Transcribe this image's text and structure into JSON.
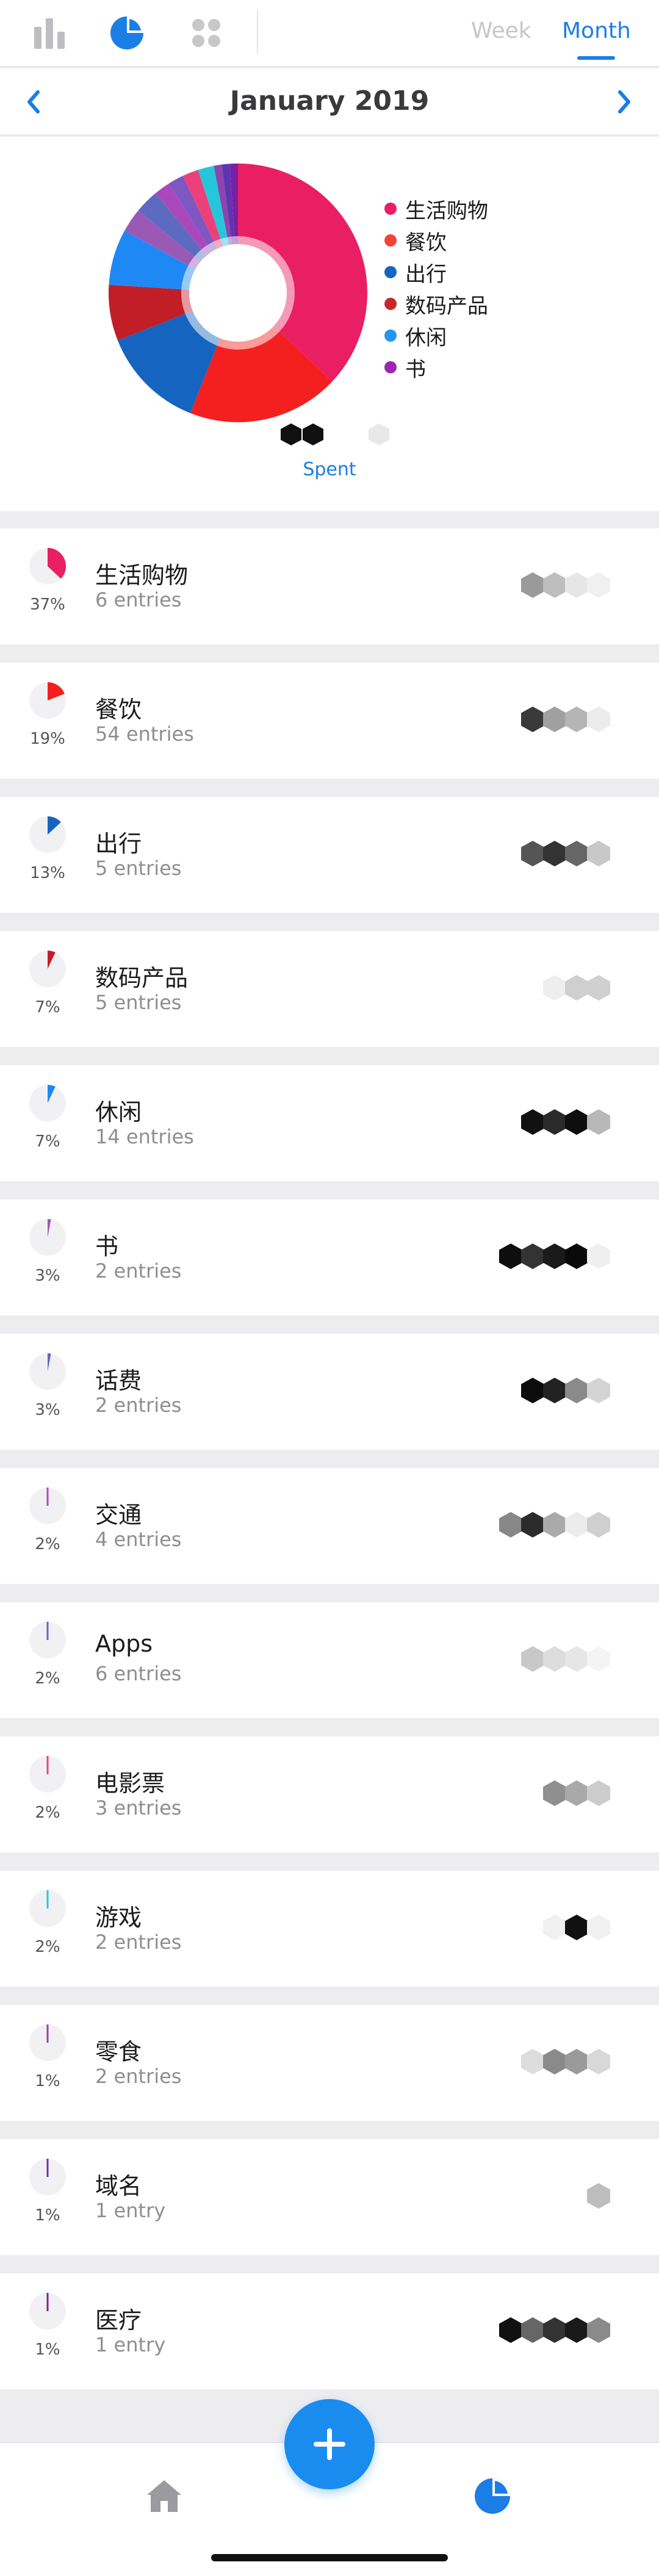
{
  "topbar": {
    "icons": [
      "bar-chart-icon",
      "pie-chart-icon",
      "grid-icon"
    ],
    "segment_week": "Week",
    "segment_month": "Month",
    "accent": "#1a7ee6"
  },
  "monthnav": {
    "title": "January 2019",
    "prev_icon": "chevron-left-icon",
    "next_icon": "chevron-right-icon"
  },
  "chart": {
    "spent_label": "Spent",
    "legend": [
      {
        "label": "生活购物",
        "color": "#e91e63"
      },
      {
        "label": "餐饮",
        "color": "#f44336"
      },
      {
        "label": "出行",
        "color": "#1565c0"
      },
      {
        "label": "数码产品",
        "color": "#c62828"
      },
      {
        "label": "休闲",
        "color": "#2196f3"
      },
      {
        "label": "书",
        "color": "#9c27b0"
      }
    ]
  },
  "chart_data": {
    "type": "pie",
    "donut": true,
    "categories": [
      "生活购物",
      "餐饮",
      "出行",
      "数码产品",
      "休闲",
      "书",
      "话费",
      "交通",
      "Apps",
      "电影票",
      "游戏",
      "零食",
      "域名",
      "医疗"
    ],
    "values": [
      37,
      19,
      13,
      7,
      7,
      3,
      3,
      2,
      2,
      2,
      2,
      1,
      1,
      1
    ],
    "colors": [
      "#e91e63",
      "#f41f1f",
      "#1565c0",
      "#c21e28",
      "#1e88f5",
      "#9b59b6",
      "#5c6bc0",
      "#ab47bc",
      "#7e57c2",
      "#ec407a",
      "#26c6da",
      "#8e44ad",
      "#5e35b1",
      "#7b1fa2"
    ]
  },
  "categories": [
    {
      "name": "生活购物",
      "entries": "6 entries",
      "pct": "37%",
      "pct_value": 37,
      "color": "#e91e63",
      "hex_shades": [
        "#9a9a9a",
        "#bdbdbd",
        "#e6e6e6",
        "#f0f0f0"
      ]
    },
    {
      "name": "餐饮",
      "entries": "54 entries",
      "pct": "19%",
      "pct_value": 19,
      "color": "#f41f1f",
      "hex_shades": [
        "#3a3a3a",
        "#a0a0a0",
        "#b5b5b5",
        "#ececec"
      ]
    },
    {
      "name": "出行",
      "entries": "5 entries",
      "pct": "13%",
      "pct_value": 13,
      "color": "#1565c0",
      "hex_shades": [
        "#555555",
        "#333333",
        "#666666",
        "#c8c8c8"
      ]
    },
    {
      "name": "数码产品",
      "entries": "5 entries",
      "pct": "7%",
      "pct_value": 7,
      "color": "#c21e28",
      "hex_shades": [
        "#eeeeee",
        "#cfcfcf",
        "#d0d0d0"
      ]
    },
    {
      "name": "休闲",
      "entries": "14 entries",
      "pct": "7%",
      "pct_value": 7,
      "color": "#1e88f5",
      "hex_shades": [
        "#111111",
        "#2a2a2a",
        "#0e0e0e",
        "#b8b8b8"
      ]
    },
    {
      "name": "书",
      "entries": "2 entries",
      "pct": "3%",
      "pct_value": 3,
      "color": "#9b59b6",
      "hex_shades": [
        "#0e0e0e",
        "#333333",
        "#1a1a1a",
        "#0a0a0a",
        "#efefef"
      ]
    },
    {
      "name": "话费",
      "entries": "2 entries",
      "pct": "3%",
      "pct_value": 3,
      "color": "#5c6bc0",
      "hex_shades": [
        "#0c0c0c",
        "#222222",
        "#8a8a8a",
        "#d4d4d4"
      ]
    },
    {
      "name": "交通",
      "entries": "4 entries",
      "pct": "2%",
      "pct_value": 2,
      "color": "#ab47bc",
      "hex_shades": [
        "#888888",
        "#2c2c2c",
        "#aaaaaa",
        "#ececec",
        "#cfcfcf"
      ]
    },
    {
      "name": "Apps",
      "entries": "6 entries",
      "pct": "2%",
      "pct_value": 2,
      "color": "#7e57c2",
      "hex_shades": [
        "#c8c8c8",
        "#dddddd",
        "#e6e6e6",
        "#f4f4f4"
      ]
    },
    {
      "name": "电影票",
      "entries": "3 entries",
      "pct": "2%",
      "pct_value": 2,
      "color": "#ec407a",
      "hex_shades": [
        "#8f8f8f",
        "#a9a9a9",
        "#cccccc"
      ]
    },
    {
      "name": "游戏",
      "entries": "2 entries",
      "pct": "2%",
      "pct_value": 2,
      "color": "#26c6da",
      "hex_shades": [
        "#f0f0f0",
        "#111111",
        "#f0f0f0"
      ]
    },
    {
      "name": "零食",
      "entries": "2 entries",
      "pct": "1%",
      "pct_value": 1,
      "color": "#8e44ad",
      "hex_shades": [
        "#dddddd",
        "#8a8a8a",
        "#9a9a9a",
        "#d8d8d8"
      ]
    },
    {
      "name": "域名",
      "entries": "1 entry",
      "pct": "1%",
      "pct_value": 1,
      "color": "#5e35b1",
      "hex_shades": [
        "#bdbdbd"
      ]
    },
    {
      "name": "医疗",
      "entries": "1 entry",
      "pct": "1%",
      "pct_value": 1,
      "color": "#7b1fa2",
      "hex_shades": [
        "#111111",
        "#666666",
        "#333333",
        "#1a1a1a",
        "#8a8a8a"
      ]
    }
  ],
  "tabbar": {
    "home_icon": "home-icon",
    "stats_icon": "pie-chart-icon",
    "add_icon": "plus-icon",
    "fab_color": "#1a8cf0"
  }
}
